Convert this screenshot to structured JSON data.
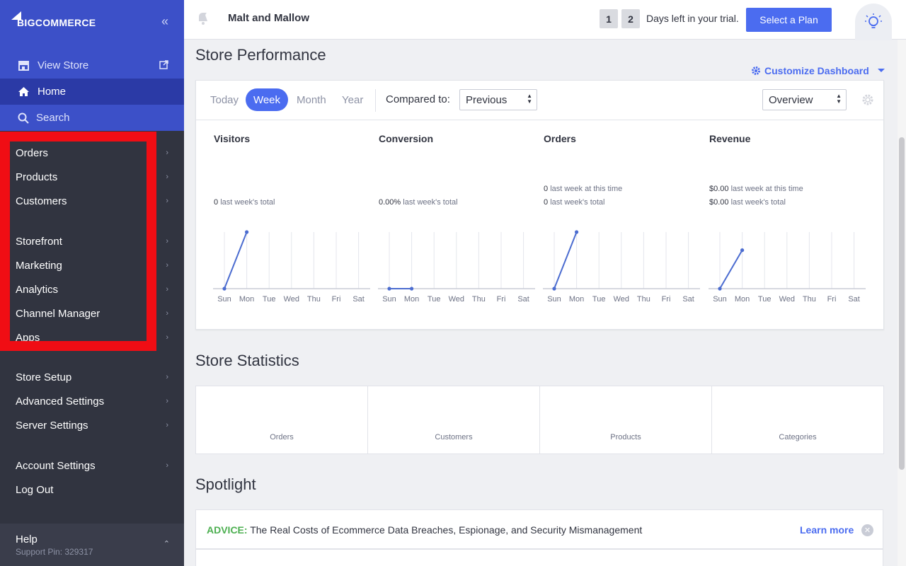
{
  "sidebar": {
    "brand": {
      "big": "BIG",
      "rest": "COMMERCE"
    },
    "view_store": "View Store",
    "home": "Home",
    "search": "Search",
    "groups": [
      [
        "Orders",
        "Products",
        "Customers"
      ],
      [
        "Storefront",
        "Marketing",
        "Analytics",
        "Channel Manager",
        "Apps"
      ],
      [
        "Store Setup",
        "Advanced Settings",
        "Server Settings"
      ],
      [
        "Account Settings",
        "Log Out"
      ]
    ],
    "help": {
      "title": "Help",
      "support_pin": "Support Pin: 329317"
    },
    "colors": {
      "sidebar_bg": "#313440",
      "top_bg": "#3c50c8",
      "active_bg": "#2b3aa6",
      "highlight": "#f00d14"
    }
  },
  "header": {
    "store_name": "Malt and Mallow",
    "trial_digits": [
      "1",
      "2"
    ],
    "trial_text": "Days left in your trial.",
    "plan_button": "Select a Plan"
  },
  "performance": {
    "title": "Store Performance",
    "customize": "Customize Dashboard",
    "periods": [
      "Today",
      "Week",
      "Month",
      "Year"
    ],
    "active_period": "Week",
    "compared_label": "Compared to:",
    "compared_value": "Previous",
    "view_value": "Overview",
    "day_labels": [
      "Sun",
      "Mon",
      "Tue",
      "Wed",
      "Thu",
      "Fri",
      "Sat"
    ],
    "metrics": [
      {
        "title": "Visitors",
        "line1": "",
        "line1_val": "",
        "line2_val": "0",
        "line2": "last week's total",
        "series": [
          0,
          1
        ]
      },
      {
        "title": "Conversion",
        "line1": "",
        "line1_val": "",
        "line2_val": "0.00%",
        "line2": "last week's total",
        "series": [
          0,
          0
        ]
      },
      {
        "title": "Orders",
        "line1_val": "0",
        "line1": "last week at this time",
        "line2_val": "0",
        "line2": "last week's total",
        "series": [
          0,
          1
        ]
      },
      {
        "title": "Revenue",
        "line1_val": "$0.00",
        "line1": "last week at this time",
        "line2_val": "$0.00",
        "line2": "last week's total",
        "series": [
          0,
          0.68
        ]
      }
    ]
  },
  "statistics": {
    "title": "Store Statistics",
    "items": [
      "Orders",
      "Customers",
      "Products",
      "Categories"
    ]
  },
  "spotlight": {
    "title": "Spotlight",
    "rows": [
      {
        "tag": "ADVICE:",
        "text": "The Real Costs of Ecommerce Data Breaches, Espionage, and Security Mismanagement",
        "link": "Learn more"
      }
    ]
  },
  "chart_data": [
    {
      "type": "line",
      "title": "Visitors",
      "categories": [
        "Sun",
        "Mon",
        "Tue",
        "Wed",
        "Thu",
        "Fri",
        "Sat"
      ],
      "values": [
        0,
        1
      ]
    },
    {
      "type": "line",
      "title": "Conversion",
      "categories": [
        "Sun",
        "Mon",
        "Tue",
        "Wed",
        "Thu",
        "Fri",
        "Sat"
      ],
      "values": [
        0,
        0
      ]
    },
    {
      "type": "line",
      "title": "Orders",
      "categories": [
        "Sun",
        "Mon",
        "Tue",
        "Wed",
        "Thu",
        "Fri",
        "Sat"
      ],
      "values": [
        0,
        1
      ]
    },
    {
      "type": "line",
      "title": "Revenue",
      "categories": [
        "Sun",
        "Mon",
        "Tue",
        "Wed",
        "Thu",
        "Fri",
        "Sat"
      ],
      "values": [
        0,
        0.68
      ]
    }
  ]
}
